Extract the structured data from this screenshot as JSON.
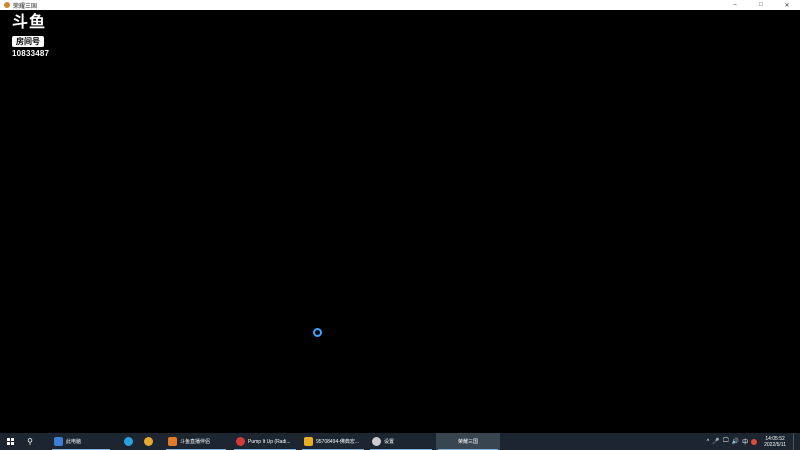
{
  "window": {
    "title": "荣耀三国",
    "controls": {
      "minimize": "–",
      "maximize": "□",
      "close": "✕"
    }
  },
  "watermark": {
    "logo_text": "斗鱼",
    "badge_text": "房间号",
    "room_number": "10833487"
  },
  "spinner": {
    "color": "#3da5ff"
  },
  "taskbar": {
    "background": "#1c2530",
    "search_icon": "search-icon",
    "apps": [
      {
        "label": "此电脑",
        "icon": "computer-icon",
        "color": "#3b7fd9"
      },
      {
        "label": "",
        "icon": "edge-icon",
        "color": "#2aa0e0"
      },
      {
        "label": "",
        "icon": "chrome-icon",
        "color": "#e8a930"
      },
      {
        "label": "斗鱼直播伴侣",
        "icon": "douyu-icon",
        "color": "#e07b2a"
      },
      {
        "label": "Pump It Up (Radi...",
        "icon": "music-icon",
        "color": "#d33b3b"
      },
      {
        "label": "95708494-佛典宏...",
        "icon": "app-icon",
        "color": "#e8b020"
      },
      {
        "label": "设置",
        "icon": "settings-icon",
        "color": "#cccccc"
      },
      {
        "label": "荣耀三国",
        "icon": "",
        "color": ""
      }
    ],
    "tray": {
      "chevron": "^",
      "mic": "🎤",
      "network": "🖵",
      "volume": "🔊",
      "ime": "中",
      "time": "14:05:52",
      "date": "2022/5/11"
    }
  }
}
